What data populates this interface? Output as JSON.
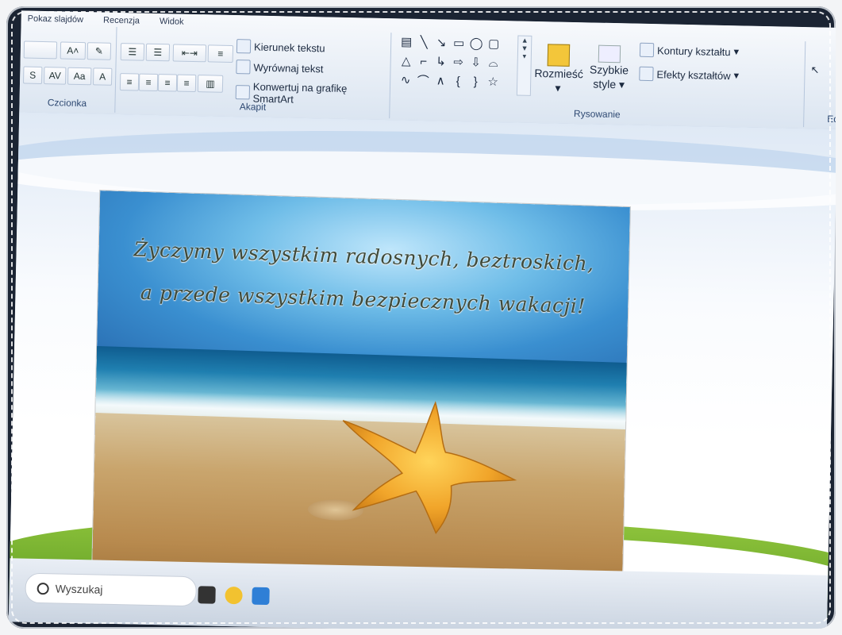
{
  "ribbon": {
    "tabs": [
      "Pokaz slajdów",
      "Recenzja",
      "Widok"
    ],
    "font_group_label": "Czcionka",
    "paragraph_group_label": "Akapit",
    "paragraph_cmds": {
      "text_direction": "Kierunek tekstu",
      "align_text": "Wyrównaj tekst",
      "convert_smartart": "Konwertuj na grafikę SmartArt"
    },
    "drawing": {
      "label": "Rysowanie",
      "arrange": "Rozmieść",
      "quick_styles_line1": "Szybkie",
      "quick_styles_line2": "style",
      "shape_outline": "Kontury kształtu",
      "shape_effects": "Efekty kształtów"
    },
    "edit_label": "Edyt"
  },
  "slide": {
    "line1": "Życzymy wszystkim radosnych, beztroskich,",
    "line2": "a przede wszystkim bezpiecznych wakacji!"
  },
  "taskbar": {
    "search_placeholder": "Wyszukaj"
  },
  "colors": {
    "ribbon_label": "#2f4a73",
    "starfish": "#f1a52a",
    "green_wave": "#6faf2c"
  }
}
